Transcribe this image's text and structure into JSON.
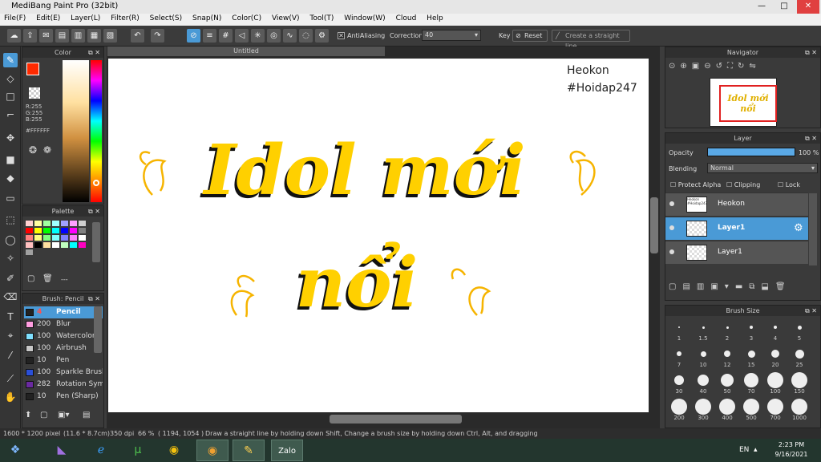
{
  "window": {
    "title": "MediBang Paint Pro (32bit)",
    "min": "—",
    "max": "□",
    "close": "✕"
  },
  "menu": [
    "File(F)",
    "Edit(E)",
    "Layer(L)",
    "Filter(R)",
    "Select(S)",
    "Snap(N)",
    "Color(C)",
    "View(V)",
    "Tool(T)",
    "Window(W)",
    "Cloud",
    "Help"
  ],
  "toolbar": {
    "antialias_label": "AntiAliasing",
    "correction_label": "Correction",
    "correction_value": "40",
    "key_label": "Key",
    "reset_label": "Reset",
    "straight_line_label": "Create a straight line"
  },
  "color_panel": {
    "title": "Color",
    "r": "R:255",
    "g": "G:255",
    "b": "B:255",
    "hex": "#FFFFFF",
    "fg": "#ff2a00",
    "bg": "#ffffff"
  },
  "palette_panel": {
    "title": "Palette",
    "swatches": [
      "#ffd0d0",
      "#ffffa0",
      "#a0ffa0",
      "#a0ffff",
      "#a0a0ff",
      "#ffa0ff",
      "#d0d0d0",
      "#ff0000",
      "#ffff00",
      "#00ff00",
      "#00ffff",
      "#0000ff",
      "#ff00ff",
      "#808080",
      "#ff8080",
      "#ffff80",
      "#80ff80",
      "#80ffff",
      "#8080ff",
      "#ff80ff",
      "#ffffff",
      "#ffc0c0",
      "#000000",
      "#ffe0a0",
      "#ffffff",
      "#c0ffc0",
      "#00ffff",
      "#ff00c0",
      "#a0a0a0"
    ],
    "extra": "---"
  },
  "brush_panel": {
    "title": "Brush: Pencil",
    "items": [
      {
        "size": "4",
        "name": "Pencil",
        "color": "#222",
        "sel": true
      },
      {
        "size": "200",
        "name": "Blur",
        "color": "#ff9ee0"
      },
      {
        "size": "100",
        "name": "Watercolor",
        "color": "#7fe0ff"
      },
      {
        "size": "100",
        "name": "Airbrush",
        "color": "#c8c8c8"
      },
      {
        "size": "10",
        "name": "Pen",
        "color": "#222"
      },
      {
        "size": "100",
        "name": "Sparkle Brush",
        "color": "#2a4fd8"
      },
      {
        "size": "282",
        "name": "Rotation Symmetry",
        "color": "#6a2aa0"
      },
      {
        "size": "10",
        "name": "Pen (Sharp)",
        "color": "#222"
      }
    ]
  },
  "canvas": {
    "tab": "Untitled",
    "watermark_line1": "Heokon",
    "watermark_line2": "#Hoidap247",
    "art_line1": "Idol mới",
    "art_line2": "nổi"
  },
  "navigator": {
    "title": "Navigator",
    "thumb_text": "Idol mới nổi"
  },
  "layer_panel": {
    "title": "Layer",
    "opacity_label": "Opacity",
    "opacity_value": "100 %",
    "opacity": 1.0,
    "blending_label": "Blending",
    "blending_value": "Normal",
    "protect_alpha": "Protect Alpha",
    "clipping": "Clipping",
    "lock": "Lock",
    "layers": [
      {
        "name": "Heokon",
        "thumb": "Heokon #Hoidap247",
        "sel": false
      },
      {
        "name": "Layer1",
        "thumb": "",
        "sel": true
      },
      {
        "name": "Layer1",
        "thumb": "",
        "sel": false
      }
    ]
  },
  "brush_size_panel": {
    "title": "Brush Size",
    "sizes": [
      "1",
      "1.5",
      "2",
      "3",
      "4",
      "5",
      "7",
      "10",
      "12",
      "15",
      "20",
      "25",
      "30",
      "40",
      "50",
      "70",
      "100",
      "150",
      "200",
      "300",
      "400",
      "500",
      "700",
      "1000"
    ]
  },
  "status": {
    "size": "1600 * 1200 pixel",
    "physical": "(11.6 * 8.7cm)",
    "dpi": "350 dpi",
    "zoom": "66 %",
    "coords": "( 1194, 1054 )",
    "hint": "Draw a straight line by holding down Shift, Change a brush size by holding down Ctrl, Alt, and dragging"
  },
  "taskbar": {
    "lang": "EN",
    "time": "2:23 PM",
    "date": "9/16/2021"
  }
}
